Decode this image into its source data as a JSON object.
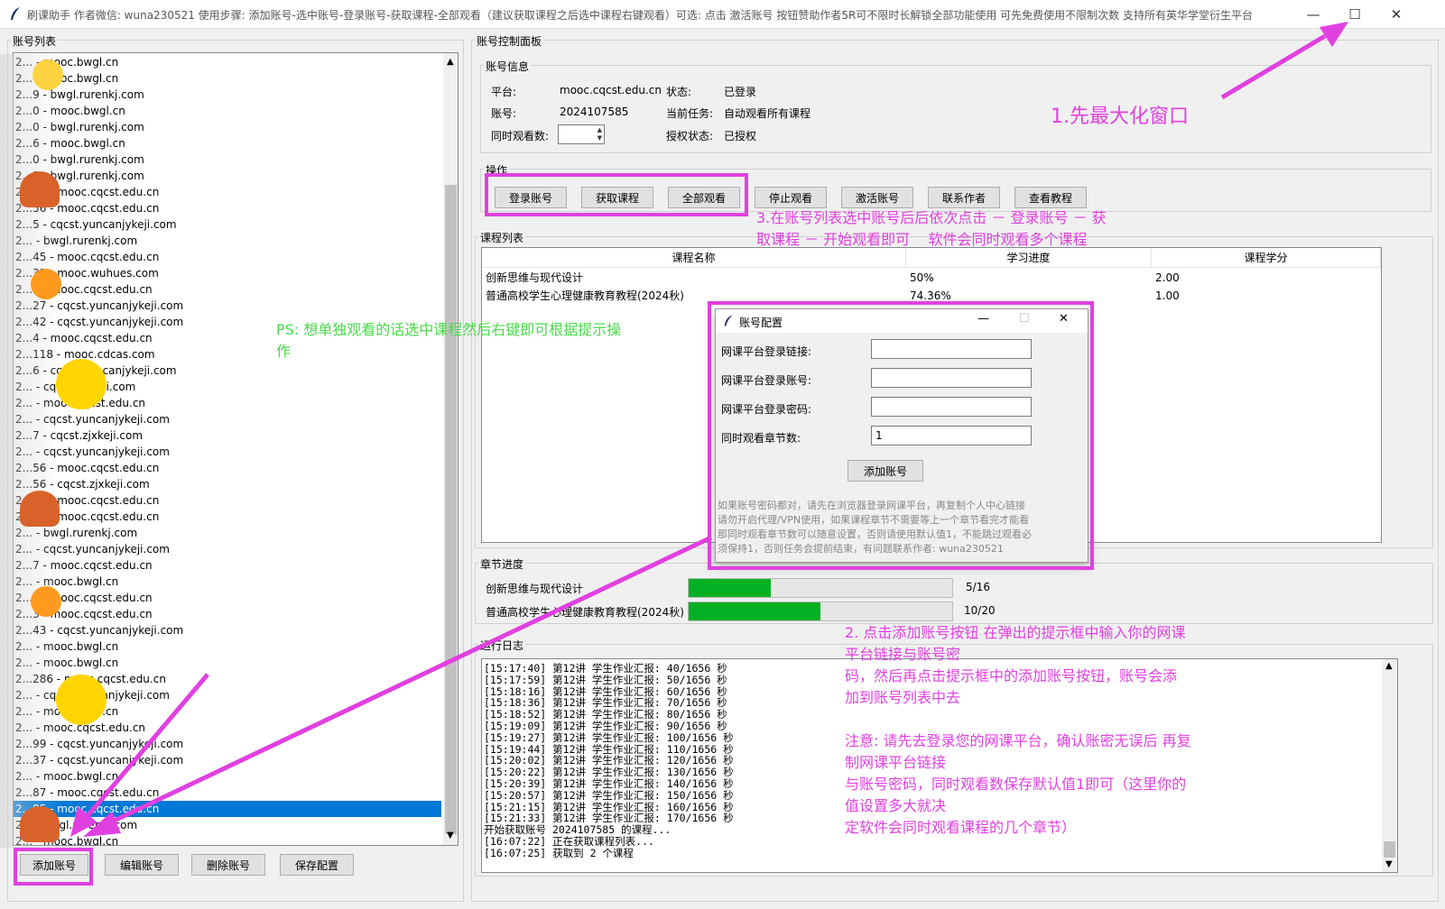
{
  "window": {
    "title": "刷课助手 作者微信: wuna230521 使用步骤: 添加账号-选中账号-登录账号-获取课程-全部观看（建议获取课程之后选中课程右键观看）可选: 点击 激活账号 按钮赞助作者5R可不限时长解锁全部功能使用 可先免费使用不限制次数 支持所有英华学堂衍生平台",
    "minimize": "—",
    "maximize": "☐",
    "close": "✕"
  },
  "account_list": {
    "label": "账号列表",
    "items": [
      "2... - mooc.bwgl.cn",
      "2... - mooc.bwgl.cn",
      "2...9 - bwgl.rurenkj.com",
      "2...0 - mooc.bwgl.cn",
      "2...0 - bwgl.rurenkj.com",
      "2...6 - mooc.bwgl.cn",
      "2...0 - bwgl.rurenkj.com",
      "2...3 - bwgl.rurenkj.com",
      "2...99 - mooc.cqcst.edu.cn",
      "2...56 - mooc.cqcst.edu.cn",
      "2...5 - cqcst.yuncanjykeji.com",
      "2... - bwgl.rurenkj.com",
      "2...45 - mooc.cqcst.edu.cn",
      "2...32 - mooc.wuhues.com",
      "2...7 - mooc.cqcst.edu.cn",
      "2...27 - cqcst.yuncanjykeji.com",
      "2...42 - cqcst.yuncanjykeji.com",
      "2...4 - mooc.cqcst.edu.cn",
      "2...118 - mooc.cdcas.com",
      "2...6 - cqcst.yuncanjykeji.com",
      "2... - cqcst.zjxkeji.com",
      "2... - mooc.cqcst.edu.cn",
      "2... - cqcst.yuncanjykeji.com",
      "2...7 - cqcst.zjxkeji.com",
      "2... - cqcst.yuncanjykeji.com",
      "2...56 - mooc.cqcst.edu.cn",
      "2...56 - cqcst.zjxkeji.com",
      "2...42 - mooc.cqcst.edu.cn",
      "2...07 - mooc.cqcst.edu.cn",
      "2... - bwgl.rurenkj.com",
      "2... - cqcst.yuncanjykeji.com",
      "2...7 - mooc.cqcst.edu.cn",
      "2... - mooc.bwgl.cn",
      "2...8 - mooc.cqcst.edu.cn",
      "2...3 - mooc.cqcst.edu.cn",
      "2...43 - cqcst.yuncanjykeji.com",
      "2... - mooc.bwgl.cn",
      "2... - mooc.bwgl.cn",
      "2...286 - mooc.cqcst.edu.cn",
      "2... - cqcst.yuncanjykeji.com",
      "2... - mooc.bwgl.cn",
      "2... - mooc.cqcst.edu.cn",
      "2...99 - cqcst.yuncanjykeji.com",
      "2...37 - cqcst.yuncanjykeji.com",
      "2... - mooc.bwgl.cn",
      "2...87 - mooc.cqcst.edu.cn",
      "2...85 - mooc.cqcst.edu.cn",
      "2... - bwgl.rurenkj.com",
      "2... - mooc.bwgl.cn"
    ],
    "selected_index": 46,
    "buttons": {
      "add": "添加账号",
      "edit": "编辑账号",
      "delete": "删除账号",
      "save": "保存配置"
    }
  },
  "control_panel": {
    "label": "账号控制面板",
    "info_label": "账号信息",
    "platform_label": "平台:",
    "platform_value": "mooc.cqcst.edu.cn",
    "status_label": "状态:",
    "status_value": "已登录",
    "account_label": "账号:",
    "account_value": "2024107585",
    "task_label": "当前任务:",
    "task_value": "自动观看所有课程",
    "concurrent_label": "同时观看数:",
    "auth_label": "授权状态:",
    "auth_value": "已授权"
  },
  "operations": {
    "label": "操作",
    "login": "登录账号",
    "get_courses": "获取课程",
    "watch_all": "全部观看",
    "stop": "停止观看",
    "activate": "激活账号",
    "contact": "联系作者",
    "tutorial": "查看教程"
  },
  "courses": {
    "label": "课程列表",
    "headers": [
      "课程名称",
      "学习进度",
      "课程学分"
    ],
    "rows": [
      [
        "创新思维与现代设计",
        "50%",
        "2.00"
      ],
      [
        "普通高校学生心理健康教育教程(2024秋)",
        "74.36%",
        "1.00"
      ]
    ]
  },
  "chapters": {
    "label": "章节进度",
    "rows": [
      {
        "name": "创新思维与现代设计",
        "progress": 0.3125,
        "text": "5/16"
      },
      {
        "name": "普通高校学生心理健康教育教程(2024秋)",
        "progress": 0.5,
        "text": "10/20"
      }
    ]
  },
  "log": {
    "label": "运行日志",
    "lines": [
      "[15:17:40] 第12讲 学生作业汇报: 40/1656 秒",
      "[15:17:59] 第12讲 学生作业汇报: 50/1656 秒",
      "[15:18:16] 第12讲 学生作业汇报: 60/1656 秒",
      "[15:18:36] 第12讲 学生作业汇报: 70/1656 秒",
      "[15:18:52] 第12讲 学生作业汇报: 80/1656 秒",
      "[15:19:09] 第12讲 学生作业汇报: 90/1656 秒",
      "[15:19:27] 第12讲 学生作业汇报: 100/1656 秒",
      "[15:19:44] 第12讲 学生作业汇报: 110/1656 秒",
      "[15:20:02] 第12讲 学生作业汇报: 120/1656 秒",
      "[15:20:22] 第12讲 学生作业汇报: 130/1656 秒",
      "[15:20:39] 第12讲 学生作业汇报: 140/1656 秒",
      "[15:20:57] 第12讲 学生作业汇报: 150/1656 秒",
      "[15:21:15] 第12讲 学生作业汇报: 160/1656 秒",
      "[15:21:33] 第12讲 学生作业汇报: 170/1656 秒",
      "开始获取账号 2024107585 的课程...",
      "[16:07:22] 正在获取课程列表...",
      "[16:07:25] 获取到 2 个课程"
    ]
  },
  "dialog": {
    "title": "账号配置",
    "url_label": "网课平台登录链接:",
    "user_label": "网课平台登录账号:",
    "pass_label": "网课平台登录密码:",
    "chapters_label": "同时观看章节数:",
    "chapters_value": "1",
    "add_button": "添加账号",
    "note": "如果账号密码都对，请先在浏览器登录网课平台，再复制个人中心链接\n请勿开启代理/VPN使用，如果课程章节不需要等上一个章节看完才能看\n那同时观看章节数可以随意设置，否则请使用默认值1，不能跳过观看必\n须保持1，否则任务会提前结束，有问题联系作者: wuna230521"
  },
  "annotations": {
    "maximize": "1.先最大化窗口",
    "step3": "3.在账号列表选中账号后后依次点击 － 登录账号 － 获\n取课程 － 开始观看即可    软件会同时观看多个课程",
    "ps": "PS: 想单独观看的话选中课程然后右键即可根据提示操\n作",
    "step2": "2. 点击添加账号按钮 在弹出的提示框中输入你的网课\n平台链接与账号密\n码，然后再点击提示框中的添加账号按钮，账号会添\n加到账号列表中去\n\n注意: 请先去登录您的网课平台，确认账密无误后 再复\n制网课平台链接\n与账号密码，同时观看数保存默认值1即可（这里你的\n值设置多大就决\n定软件会同时观看课程的几个章节）"
  },
  "colors": {
    "annotation": "#e040e0",
    "selection": "#0078d7",
    "progress": "#06b025"
  }
}
